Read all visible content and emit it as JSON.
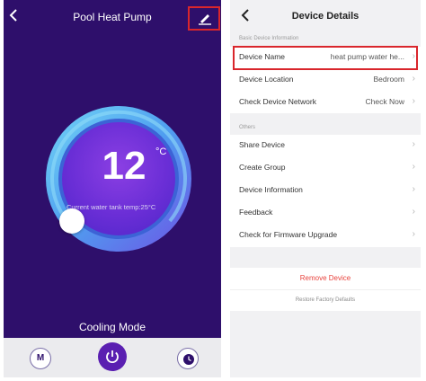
{
  "left": {
    "title": "Pool Heat Pump",
    "temperature": "12",
    "unit": "°C",
    "tank_temp_text": "Current water tank temp:25°C",
    "mode": "Cooling Mode",
    "mode_button_label": "M",
    "colors": {
      "background": "#2e0f6b",
      "accent": "#5a1fb1",
      "highlight": "#d9262c"
    }
  },
  "right": {
    "title": "Device Details",
    "section_basic": "Basic Device Information",
    "rows_basic": [
      {
        "label": "Device Name",
        "value": "heat pump water he..."
      },
      {
        "label": "Device Location",
        "value": "Bedroom"
      },
      {
        "label": "Check Device Network",
        "value": "Check Now"
      }
    ],
    "section_others": "Others",
    "rows_others": [
      {
        "label": "Share Device"
      },
      {
        "label": "Create Group"
      },
      {
        "label": "Device Information"
      },
      {
        "label": "Feedback"
      },
      {
        "label": "Check for Firmware Upgrade"
      }
    ],
    "remove_label": "Remove Device",
    "restore_label": "Restore Factory Defaults",
    "colors": {
      "remove": "#e8433d"
    }
  }
}
